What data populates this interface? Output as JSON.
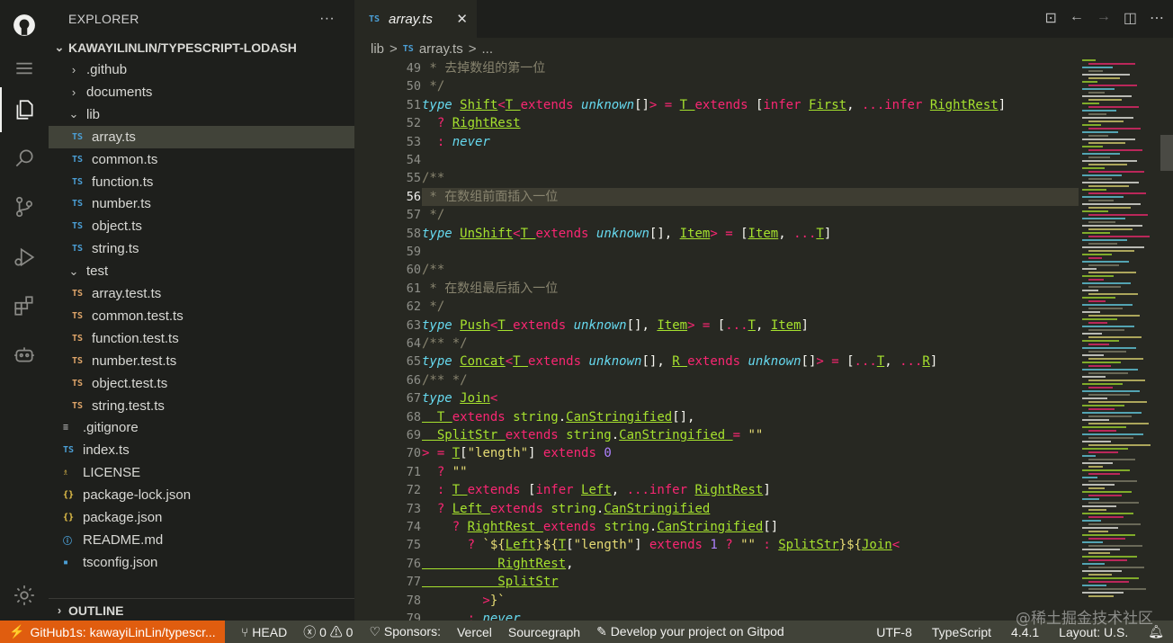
{
  "colors": {
    "keyword": "#66d9ef",
    "type_name": "#a6e22e",
    "operator": "#f92672",
    "comment": "#88846f",
    "string": "#e6db74",
    "number": "#ae81ff",
    "text": "#f8f8f2",
    "accent": "#e05d0f"
  },
  "explorer": {
    "title": "EXPLORER",
    "more_label": "···",
    "project": "KAWAYILINLIN/TYPESCRIPT-LODASH",
    "outline_label": "OUTLINE",
    "items": [
      {
        "label": ".github",
        "kind": "folder",
        "expanded": false,
        "depth": 0
      },
      {
        "label": "documents",
        "kind": "folder",
        "expanded": false,
        "depth": 0
      },
      {
        "label": "lib",
        "kind": "folder",
        "expanded": true,
        "depth": 0
      },
      {
        "label": "array.ts",
        "kind": "ts",
        "depth": 1,
        "selected": true
      },
      {
        "label": "common.ts",
        "kind": "ts",
        "depth": 1
      },
      {
        "label": "function.ts",
        "kind": "ts",
        "depth": 1
      },
      {
        "label": "number.ts",
        "kind": "ts",
        "depth": 1
      },
      {
        "label": "object.ts",
        "kind": "ts",
        "depth": 1
      },
      {
        "label": "string.ts",
        "kind": "ts",
        "depth": 1
      },
      {
        "label": "test",
        "kind": "folder",
        "expanded": true,
        "depth": 0
      },
      {
        "label": "array.test.ts",
        "kind": "test",
        "depth": 1
      },
      {
        "label": "common.test.ts",
        "kind": "test",
        "depth": 1
      },
      {
        "label": "function.test.ts",
        "kind": "test",
        "depth": 1
      },
      {
        "label": "number.test.ts",
        "kind": "test",
        "depth": 1
      },
      {
        "label": "object.test.ts",
        "kind": "test",
        "depth": 1
      },
      {
        "label": "string.test.ts",
        "kind": "test",
        "depth": 1
      },
      {
        "label": ".gitignore",
        "kind": "gitignore",
        "depth": 0
      },
      {
        "label": "index.ts",
        "kind": "ts",
        "depth": 0
      },
      {
        "label": "LICENSE",
        "kind": "license",
        "depth": 0
      },
      {
        "label": "package-lock.json",
        "kind": "json",
        "depth": 0
      },
      {
        "label": "package.json",
        "kind": "json",
        "depth": 0
      },
      {
        "label": "README.md",
        "kind": "info",
        "depth": 0
      },
      {
        "label": "tsconfig.json",
        "kind": "tsconfig",
        "depth": 0
      }
    ]
  },
  "tab": {
    "icon_text": "TS",
    "label": "array.ts",
    "close": "✕"
  },
  "breadcrumb": {
    "folder": "lib",
    "sep": ">",
    "icon_text": "TS",
    "file": "array.ts",
    "tail": "..."
  },
  "editor": {
    "current_line": 56,
    "lines": [
      {
        "n": 49,
        "t": [
          [
            "cm",
            " * 去掉数组的第一位"
          ]
        ]
      },
      {
        "n": 50,
        "t": [
          [
            "cm",
            " */"
          ]
        ]
      },
      {
        "n": 51,
        "t": [
          [
            "kw",
            "type "
          ],
          [
            "ty",
            "Shift"
          ],
          [
            "op",
            "<"
          ],
          [
            "ty",
            "T "
          ],
          [
            "op",
            "extends "
          ],
          [
            "kw",
            "unknown"
          ],
          [
            "tx",
            "[]"
          ],
          [
            "op",
            "> = "
          ],
          [
            "ty",
            "T "
          ],
          [
            "op",
            "extends "
          ],
          [
            "tx",
            "["
          ],
          [
            "op",
            "infer "
          ],
          [
            "ty",
            "First"
          ],
          [
            "tx",
            ", "
          ],
          [
            "op",
            "...infer "
          ],
          [
            "ty",
            "RightRest"
          ],
          [
            "tx",
            "]"
          ]
        ]
      },
      {
        "n": 52,
        "t": [
          [
            "op",
            "  ? "
          ],
          [
            "ty",
            "RightRest"
          ]
        ]
      },
      {
        "n": 53,
        "t": [
          [
            "op",
            "  : "
          ],
          [
            "kw",
            "never"
          ]
        ]
      },
      {
        "n": 54,
        "t": []
      },
      {
        "n": 55,
        "t": [
          [
            "cm",
            "/**"
          ]
        ]
      },
      {
        "n": 56,
        "t": [
          [
            "cm",
            " * 在数组前面插入一位"
          ]
        ]
      },
      {
        "n": 57,
        "t": [
          [
            "cm",
            " */"
          ]
        ]
      },
      {
        "n": 58,
        "t": [
          [
            "kw",
            "type "
          ],
          [
            "ty",
            "UnShift"
          ],
          [
            "op",
            "<"
          ],
          [
            "ty",
            "T "
          ],
          [
            "op",
            "extends "
          ],
          [
            "kw",
            "unknown"
          ],
          [
            "tx",
            "[], "
          ],
          [
            "ty",
            "Item"
          ],
          [
            "op",
            "> = "
          ],
          [
            "tx",
            "["
          ],
          [
            "ty",
            "Item"
          ],
          [
            "tx",
            ", "
          ],
          [
            "op",
            "..."
          ],
          [
            "ty",
            "T"
          ],
          [
            "tx",
            "]"
          ]
        ]
      },
      {
        "n": 59,
        "t": []
      },
      {
        "n": 60,
        "t": [
          [
            "cm",
            "/**"
          ]
        ]
      },
      {
        "n": 61,
        "t": [
          [
            "cm",
            " * 在数组最后插入一位"
          ]
        ]
      },
      {
        "n": 62,
        "t": [
          [
            "cm",
            " */"
          ]
        ]
      },
      {
        "n": 63,
        "t": [
          [
            "kw",
            "type "
          ],
          [
            "ty",
            "Push"
          ],
          [
            "op",
            "<"
          ],
          [
            "ty",
            "T "
          ],
          [
            "op",
            "extends "
          ],
          [
            "kw",
            "unknown"
          ],
          [
            "tx",
            "[], "
          ],
          [
            "ty",
            "Item"
          ],
          [
            "op",
            "> = "
          ],
          [
            "tx",
            "["
          ],
          [
            "op",
            "..."
          ],
          [
            "ty",
            "T"
          ],
          [
            "tx",
            ", "
          ],
          [
            "ty",
            "Item"
          ],
          [
            "tx",
            "]"
          ]
        ]
      },
      {
        "n": 64,
        "t": [
          [
            "cm",
            "/** */"
          ]
        ]
      },
      {
        "n": 65,
        "t": [
          [
            "kw",
            "type "
          ],
          [
            "ty",
            "Concat"
          ],
          [
            "op",
            "<"
          ],
          [
            "ty",
            "T "
          ],
          [
            "op",
            "extends "
          ],
          [
            "kw",
            "unknown"
          ],
          [
            "tx",
            "[], "
          ],
          [
            "ty",
            "R "
          ],
          [
            "op",
            "extends "
          ],
          [
            "kw",
            "unknown"
          ],
          [
            "tx",
            "[]"
          ],
          [
            "op",
            "> = "
          ],
          [
            "tx",
            "["
          ],
          [
            "op",
            "..."
          ],
          [
            "ty",
            "T"
          ],
          [
            "tx",
            ", "
          ],
          [
            "op",
            "..."
          ],
          [
            "ty",
            "R"
          ],
          [
            "tx",
            "]"
          ]
        ]
      },
      {
        "n": 66,
        "t": [
          [
            "cm",
            "/** */"
          ]
        ]
      },
      {
        "n": 67,
        "t": [
          [
            "kw",
            "type "
          ],
          [
            "ty",
            "Join"
          ],
          [
            "op",
            "<"
          ]
        ]
      },
      {
        "n": 68,
        "t": [
          [
            "ty",
            "  T "
          ],
          [
            "op",
            "extends "
          ],
          [
            "ty",
            "string"
          ],
          [
            "tx",
            "."
          ],
          [
            "ty",
            "CanStringified"
          ],
          [
            "tx",
            "[],"
          ]
        ]
      },
      {
        "n": 69,
        "t": [
          [
            "ty",
            "  SplitStr "
          ],
          [
            "op",
            "extends "
          ],
          [
            "ty",
            "string"
          ],
          [
            "tx",
            "."
          ],
          [
            "ty",
            "CanStringified "
          ],
          [
            "op",
            "= "
          ],
          [
            "st",
            "\"\""
          ]
        ]
      },
      {
        "n": 70,
        "t": [
          [
            "op",
            "> = "
          ],
          [
            "ty",
            "T"
          ],
          [
            "tx",
            "["
          ],
          [
            "st",
            "\"length\""
          ],
          [
            "tx",
            "] "
          ],
          [
            "op",
            "extends "
          ],
          [
            "nu",
            "0"
          ]
        ]
      },
      {
        "n": 71,
        "t": [
          [
            "op",
            "  ? "
          ],
          [
            "st",
            "\"\""
          ]
        ]
      },
      {
        "n": 72,
        "t": [
          [
            "op",
            "  : "
          ],
          [
            "ty",
            "T "
          ],
          [
            "op",
            "extends "
          ],
          [
            "tx",
            "["
          ],
          [
            "op",
            "infer "
          ],
          [
            "ty",
            "Left"
          ],
          [
            "tx",
            ", "
          ],
          [
            "op",
            "...infer "
          ],
          [
            "ty",
            "RightRest"
          ],
          [
            "tx",
            "]"
          ]
        ]
      },
      {
        "n": 73,
        "t": [
          [
            "op",
            "  ? "
          ],
          [
            "ty",
            "Left "
          ],
          [
            "op",
            "extends "
          ],
          [
            "ty",
            "string"
          ],
          [
            "tx",
            "."
          ],
          [
            "ty",
            "CanStringified"
          ]
        ]
      },
      {
        "n": 74,
        "t": [
          [
            "op",
            "    ? "
          ],
          [
            "ty",
            "RightRest "
          ],
          [
            "op",
            "extends "
          ],
          [
            "ty",
            "string"
          ],
          [
            "tx",
            "."
          ],
          [
            "ty",
            "CanStringified"
          ],
          [
            "tx",
            "[]"
          ]
        ]
      },
      {
        "n": 75,
        "t": [
          [
            "op",
            "      ? "
          ],
          [
            "st",
            "`${"
          ],
          [
            "ty",
            "Left"
          ],
          [
            "st",
            "}${"
          ],
          [
            "ty",
            "T"
          ],
          [
            "tx",
            "["
          ],
          [
            "st",
            "\"length\""
          ],
          [
            "tx",
            "] "
          ],
          [
            "op",
            "extends "
          ],
          [
            "nu",
            "1 "
          ],
          [
            "op",
            "? "
          ],
          [
            "st",
            "\"\" "
          ],
          [
            "op",
            ": "
          ],
          [
            "ty",
            "SplitStr"
          ],
          [
            "st",
            "}${"
          ],
          [
            "ty",
            "Join"
          ],
          [
            "op",
            "<"
          ]
        ]
      },
      {
        "n": 76,
        "t": [
          [
            "ty",
            "          RightRest"
          ],
          [
            "tx",
            ","
          ]
        ]
      },
      {
        "n": 77,
        "t": [
          [
            "ty",
            "          SplitStr"
          ]
        ]
      },
      {
        "n": 78,
        "t": [
          [
            "op",
            "        >"
          ],
          [
            "st",
            "}`"
          ]
        ]
      },
      {
        "n": 79,
        "t": [
          [
            "op",
            "      : "
          ],
          [
            "kw",
            "never"
          ]
        ]
      }
    ]
  },
  "status": {
    "remote": "GitHub1s: kawayiLinLin/typescr...",
    "branch": "HEAD",
    "errors": "0",
    "warnings": "0",
    "sponsors": "Sponsors:",
    "vercel": "Vercel",
    "sourcegraph": "Sourcegraph",
    "gitpod": "Develop your project on Gitpod",
    "encoding": "UTF-8",
    "language": "TypeScript",
    "version": "4.4.1",
    "layout": "Layout: U.S."
  },
  "watermark": "@稀土掘金技术社区"
}
